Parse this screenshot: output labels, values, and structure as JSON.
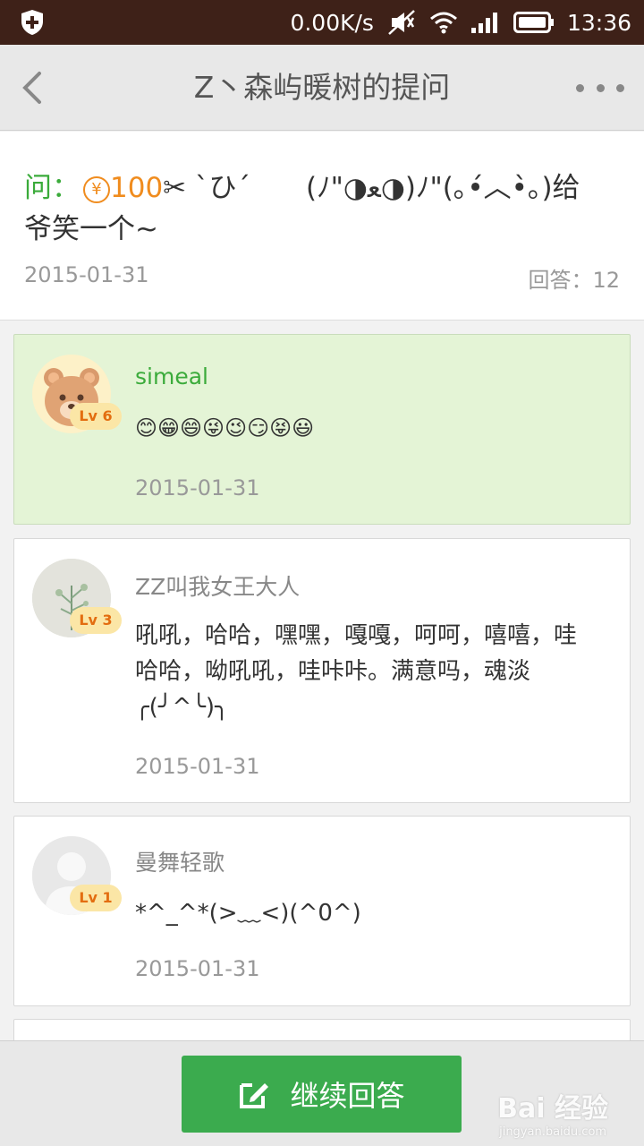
{
  "status_bar": {
    "speed": "0.00K/s",
    "time": "13:36"
  },
  "header": {
    "back_icon": "chevron-left-icon",
    "title": "Z丶森屿暖树的提问",
    "more_icon": "more-dots-icon"
  },
  "question": {
    "prefix": "问：",
    "coin_symbol": "¥",
    "reward": "100",
    "text": "✂ ˋひˊ　　(ﾉ\"◑ﻌ◑)ﾉ\"(｡•́︿•̀｡)给爷笑一个~",
    "date": "2015-01-31",
    "answer_count": "回答：12"
  },
  "answers": [
    {
      "user": "simeal",
      "level": "Lv 6",
      "text": "😊😁😄😜😉😏😝😃",
      "date": "2015-01-31",
      "best": true
    },
    {
      "user": "ZZ叫我女王大人",
      "level": "Lv 3",
      "text": "吼吼，哈哈，嘿嘿，嘎嘎，呵呵，嘻嘻，哇哈哈，呦吼吼，哇咔咔。满意吗，魂淡 ╭(╯^╰)╮",
      "date": "2015-01-31",
      "best": false
    },
    {
      "user": "曼舞轻歌",
      "level": "Lv 1",
      "text": "*^_^*(>﹏<)(^0^)",
      "date": "2015-01-31",
      "best": false
    }
  ],
  "bottom_bar": {
    "button_label": "继续回答",
    "button_icon": "edit-icon",
    "watermark": "Bai 经验",
    "watermark_sub": "jingyan.baidu.com"
  },
  "colors": {
    "accent_green": "#3bab4e",
    "reward_orange": "#f08c1e",
    "status_bar_bg": "#3e2118",
    "best_answer_bg": "#e4f4d6"
  }
}
